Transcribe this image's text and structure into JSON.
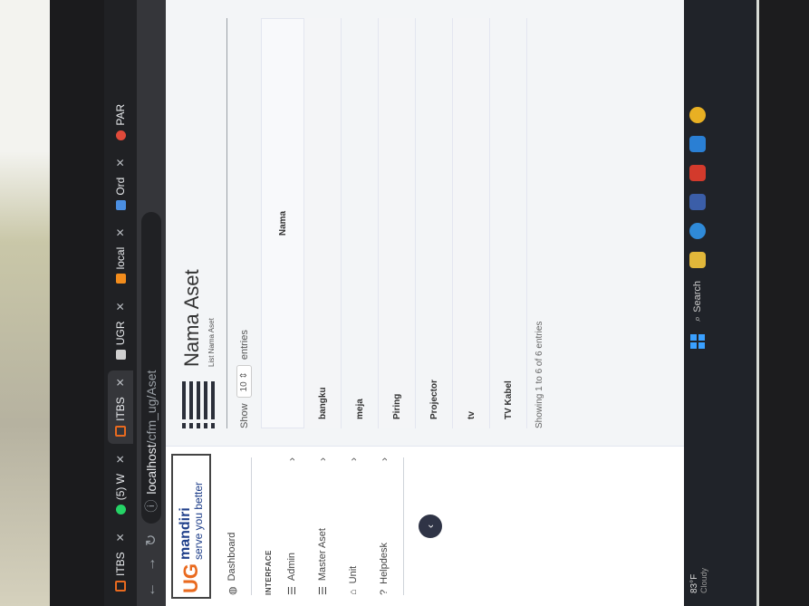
{
  "browser": {
    "tabs": [
      {
        "label": "ITBS",
        "icon": "square-icon",
        "color": "#e96a1f"
      },
      {
        "label": "(5) W",
        "icon": "whatsapp-icon",
        "color": "#25d366"
      },
      {
        "label": "ITBS",
        "icon": "square-icon",
        "color": "#e96a1f",
        "active": true
      },
      {
        "label": "UGR",
        "icon": "page-icon",
        "color": "#cfcfcf"
      },
      {
        "label": "local",
        "icon": "xampp-icon",
        "color": "#f28c1c"
      },
      {
        "label": "Ord",
        "icon": "chart-icon",
        "color": "#4b8fe2"
      },
      {
        "label": "PAR",
        "icon": "red-dot-icon",
        "color": "#e04a3a"
      }
    ],
    "address": {
      "host": "localhost",
      "path": "/cfm_ug/Aset"
    }
  },
  "sidebar": {
    "brand": {
      "ug": "UG",
      "mandiri": "mandiri",
      "tagline": "serve you better"
    },
    "dashboard": "Dashboard",
    "heading": "INTERFACE",
    "items": [
      {
        "label": "Admin",
        "icon": "list-icon"
      },
      {
        "label": "Master Aset",
        "icon": "list-icon"
      },
      {
        "label": "Unit",
        "icon": "home-icon"
      },
      {
        "label": "Helpdesk",
        "icon": "help-icon"
      }
    ],
    "collapse": "‹"
  },
  "main": {
    "title": "Nama Aset",
    "subtitle": "List Nama Aset",
    "show_label": "Show",
    "show_value": "10",
    "entries_label": "entries",
    "column_header": "Nama",
    "rows": [
      "bangku",
      "meja",
      "Piring",
      "Projector",
      "tv",
      "TV Kabel"
    ],
    "info": "Showing 1 to 6 of 6 entries"
  },
  "taskbar": {
    "temp": "83°F",
    "weather": "Cloudy",
    "search": "Search"
  }
}
